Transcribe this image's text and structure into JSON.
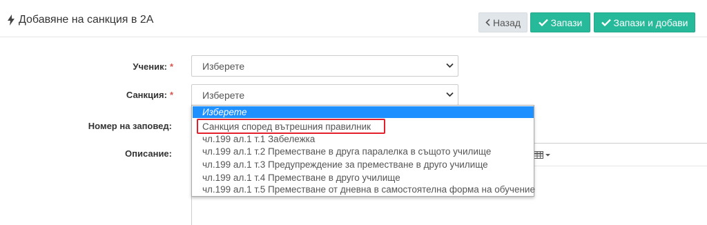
{
  "header": {
    "title": "Добавяне на санкция в 2А",
    "back_label": "Назад",
    "save_label": "Запази",
    "save_add_label": "Запази и добави"
  },
  "form": {
    "student_label": "Ученик:",
    "sanction_label": "Санкция:",
    "order_label": "Номер на заповед:",
    "description_label": "Описание:",
    "required_mark": "*",
    "student_value": "Изберете",
    "sanction_value": "Изберете"
  },
  "dropdown": {
    "options": [
      "Изберете",
      "Санкция според вътрешния правилник",
      "чл.199 ал.1 т.1 Забележка",
      "чл.199 ал.1 т.2 Преместване в друга паралелка в същото училище",
      "чл.199 ал.1 т.3 Предупреждение за преместване в друго училище",
      "чл.199 ал.1 т.4 Преместване в друго училище",
      "чл.199 ал.1 т.5 Преместване от дневна в самостоятелна форма на обучение"
    ]
  },
  "colors": {
    "accent": "#26b99a",
    "selected_option": "#1e90ff",
    "highlight": "#e3202a",
    "required": "#d9534f"
  },
  "icons": {
    "title": "bolt-icon",
    "back": "chevron-left-icon",
    "save": "check-icon",
    "select": "chevron-down-icon",
    "editor": "table-icon"
  }
}
